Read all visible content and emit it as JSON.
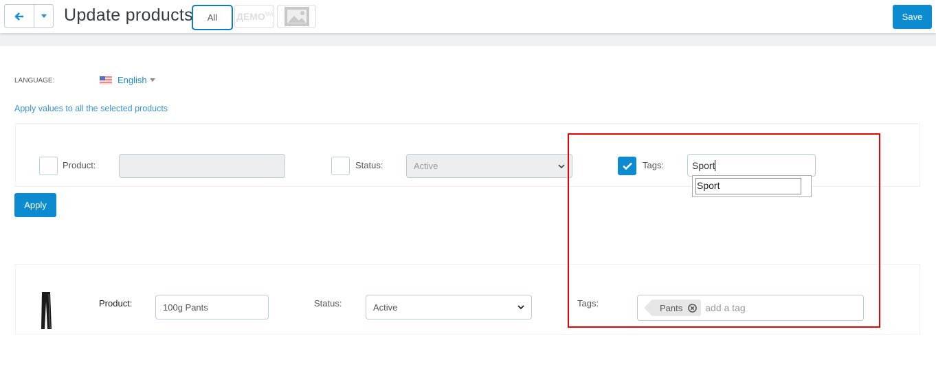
{
  "header": {
    "title": "Update products",
    "tabs": [
      {
        "label": "All"
      },
      {
        "label": "ДЕМО",
        "sup": "МА"
      }
    ],
    "save_label": "Save"
  },
  "language": {
    "label": "LANGUAGE:",
    "value": "English"
  },
  "apply_note": "Apply values to all the selected products",
  "bulk": {
    "product_label": "Product:",
    "product_value": "",
    "status_label": "Status:",
    "status_value": "Active",
    "status_checked": false,
    "product_checked": false,
    "tags_label": "Tags:",
    "tags_checked": true,
    "tags_input": "Sport",
    "suggestions": [
      "Sport"
    ],
    "apply_label": "Apply"
  },
  "products": [
    {
      "product_label": "Product:",
      "name": "100g Pants",
      "status_label": "Status:",
      "status": "Active",
      "tags_label": "Tags:",
      "tags": [
        "Pants"
      ],
      "tag_placeholder": "add a tag"
    }
  ],
  "colors": {
    "accent": "#0c8bd0",
    "highlight": "#ee0000"
  }
}
